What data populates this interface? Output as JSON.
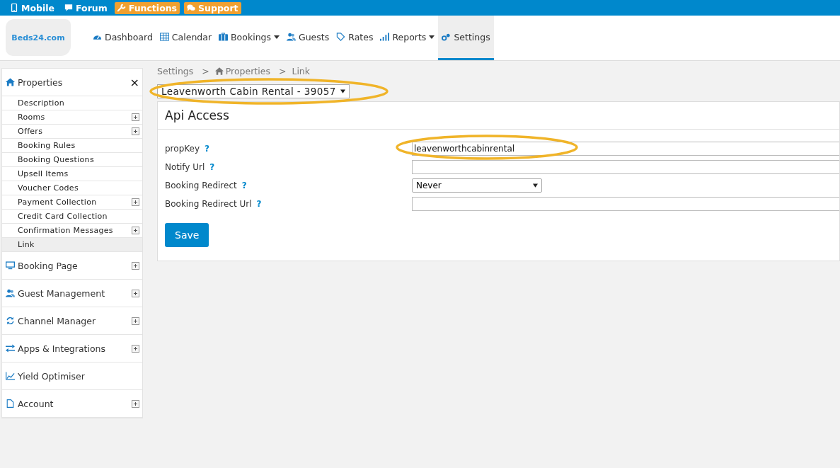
{
  "top_bar": {
    "links": [
      {
        "label": "Mobile",
        "kind": "plain"
      },
      {
        "label": "Forum",
        "kind": "plain"
      },
      {
        "label": "Functions",
        "kind": "badge"
      },
      {
        "label": "Support",
        "kind": "badge"
      }
    ]
  },
  "logo": {
    "text": "Beds24.com"
  },
  "nav": [
    {
      "label": "Dashboard",
      "dropdown": false,
      "selected": false
    },
    {
      "label": "Calendar",
      "dropdown": false,
      "selected": false
    },
    {
      "label": "Bookings",
      "dropdown": true,
      "selected": false
    },
    {
      "label": "Guests",
      "dropdown": false,
      "selected": false
    },
    {
      "label": "Rates",
      "dropdown": false,
      "selected": false
    },
    {
      "label": "Reports",
      "dropdown": true,
      "selected": false
    },
    {
      "label": "Settings",
      "dropdown": false,
      "selected": true
    }
  ],
  "sidebar": {
    "sections": [
      {
        "label": "Properties",
        "expanded": true,
        "close": "×",
        "children": [
          {
            "label": "Description",
            "expandable": false,
            "selected": false
          },
          {
            "label": "Rooms",
            "expandable": true,
            "selected": false
          },
          {
            "label": "Offers",
            "expandable": true,
            "selected": false
          },
          {
            "label": "Booking Rules",
            "expandable": false,
            "selected": false
          },
          {
            "label": "Booking Questions",
            "expandable": false,
            "selected": false
          },
          {
            "label": "Upsell Items",
            "expandable": false,
            "selected": false
          },
          {
            "label": "Voucher Codes",
            "expandable": false,
            "selected": false
          },
          {
            "label": "Payment Collection",
            "expandable": true,
            "selected": false
          },
          {
            "label": "Credit Card Collection",
            "expandable": false,
            "selected": false
          },
          {
            "label": "Confirmation Messages",
            "expandable": true,
            "selected": false
          },
          {
            "label": "Link",
            "expandable": false,
            "selected": true
          }
        ]
      },
      {
        "label": "Booking Page",
        "expandable": true
      },
      {
        "label": "Guest Management",
        "expandable": true
      },
      {
        "label": "Channel Manager",
        "expandable": true
      },
      {
        "label": "Apps & Integrations",
        "expandable": true
      },
      {
        "label": "Yield Optimiser",
        "expandable": false
      },
      {
        "label": "Account",
        "expandable": true
      }
    ]
  },
  "breadcrumb": [
    {
      "label": "Settings"
    },
    {
      "separator": ">",
      "label": "Properties"
    },
    {
      "separator": ">",
      "label": "Link"
    }
  ],
  "property_select": {
    "value": "Leavenworth Cabin Rental - 39057",
    "highlighted": true
  },
  "panel": {
    "title": "Api Access",
    "fields": [
      {
        "label": "propKey",
        "help": "?",
        "kind": "text",
        "value": "leavenworthcabinrental",
        "highlighted": true
      },
      {
        "label": "Notify Url",
        "help": "?",
        "kind": "text",
        "highlighted": false
      },
      {
        "label": "Booking Redirect",
        "help": "?",
        "kind": "select",
        "value": "Never",
        "highlighted": false
      },
      {
        "label": "Booking Redirect Url",
        "help": "?",
        "kind": "text",
        "highlighted": false
      }
    ],
    "button": "Save"
  }
}
